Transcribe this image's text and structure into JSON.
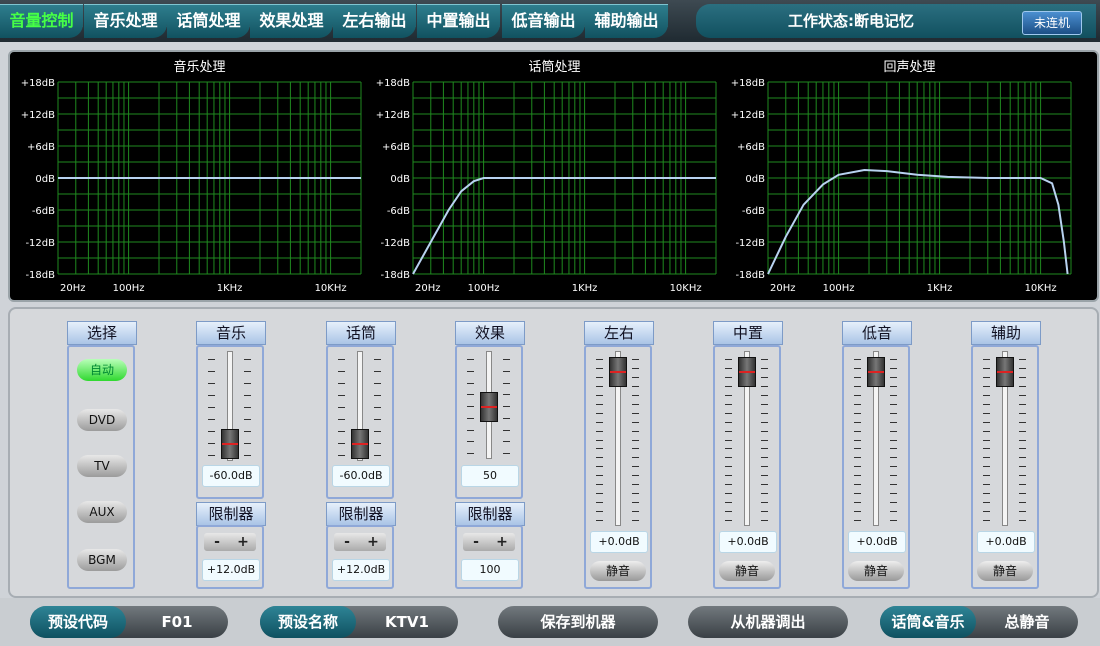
{
  "tabs": [
    {
      "label": "音量控制",
      "active": true
    },
    {
      "label": "音乐处理",
      "active": false
    },
    {
      "label": "话筒处理",
      "active": false
    },
    {
      "label": "效果处理",
      "active": false
    },
    {
      "label": "左右输出",
      "active": false
    },
    {
      "label": "中置输出",
      "active": false
    },
    {
      "label": "低音输出",
      "active": false
    },
    {
      "label": "辅助输出",
      "active": false
    }
  ],
  "status": {
    "text": "工作状态:断电记忆",
    "connect_label": "未连机"
  },
  "colors": {
    "active_tab": "#46ff46",
    "grid": "#1f8a1f",
    "curve": "#b8d2f0"
  },
  "graphs": [
    {
      "title": "音乐处理",
      "y_ticks": [
        "+18dB",
        "+12dB",
        "+6dB",
        "0dB",
        "-6dB",
        "-12dB",
        "-18dB"
      ],
      "x_ticks": [
        "20Hz",
        "100Hz",
        "1KHz",
        "10KHz"
      ],
      "curve": [
        [
          20,
          0
        ],
        [
          20000,
          0
        ]
      ]
    },
    {
      "title": "话筒处理",
      "y_ticks": [
        "+18dB",
        "+12dB",
        "+6dB",
        "0dB",
        "-6dB",
        "-12dB",
        "-18dB"
      ],
      "x_ticks": [
        "20Hz",
        "100Hz",
        "1KHz",
        "10KHz"
      ],
      "curve": [
        [
          20,
          -18
        ],
        [
          30,
          -12
        ],
        [
          45,
          -6
        ],
        [
          60,
          -2.5
        ],
        [
          80,
          -0.6
        ],
        [
          100,
          0
        ],
        [
          20000,
          0
        ]
      ]
    },
    {
      "title": "回声处理",
      "y_ticks": [
        "+18dB",
        "+12dB",
        "+6dB",
        "0dB",
        "-6dB",
        "-12dB",
        "-18dB"
      ],
      "x_ticks": [
        "20Hz",
        "100Hz",
        "1KHz",
        "10KHz"
      ],
      "curve": [
        [
          20,
          -18
        ],
        [
          30,
          -11
        ],
        [
          45,
          -5
        ],
        [
          70,
          -1.2
        ],
        [
          100,
          0.6
        ],
        [
          180,
          1.5
        ],
        [
          300,
          1.3
        ],
        [
          600,
          0.6
        ],
        [
          1200,
          0.2
        ],
        [
          3000,
          0
        ],
        [
          10000,
          0
        ],
        [
          13000,
          -1
        ],
        [
          15000,
          -5
        ],
        [
          17000,
          -12
        ],
        [
          18500,
          -18
        ]
      ]
    }
  ],
  "select": {
    "title": "选择",
    "options": [
      {
        "label": "自动",
        "on": true
      },
      {
        "label": "DVD",
        "on": false
      },
      {
        "label": "TV",
        "on": false
      },
      {
        "label": "AUX",
        "on": false
      },
      {
        "label": "BGM",
        "on": false
      }
    ]
  },
  "channels": [
    {
      "title": "音乐",
      "value": "-60.0dB",
      "level": 0.0,
      "limiter": {
        "title": "限制器",
        "value": "+12.0dB",
        "type": "stepper"
      }
    },
    {
      "title": "话筒",
      "value": "-60.0dB",
      "level": 0.0,
      "limiter": {
        "title": "限制器",
        "value": "+12.0dB",
        "type": "stepper"
      }
    },
    {
      "title": "效果",
      "value": "50",
      "level": 0.5,
      "limiter": {
        "title": "限制器",
        "value": "100",
        "type": "stepper"
      }
    },
    {
      "title": "左右",
      "value": "+0.0dB",
      "level": 1.0,
      "mute": "静音"
    },
    {
      "title": "中置",
      "value": "+0.0dB",
      "level": 1.0,
      "mute": "静音"
    },
    {
      "title": "低音",
      "value": "+0.0dB",
      "level": 1.0,
      "mute": "静音"
    },
    {
      "title": "辅助",
      "value": "+0.0dB",
      "level": 1.0,
      "mute": "静音"
    }
  ],
  "stepper": {
    "minus": "-",
    "plus": "+"
  },
  "bottom": {
    "preset_code_label": "预设代码",
    "preset_code_value": "F01",
    "preset_name_label": "预设名称",
    "preset_name_value": "KTV1",
    "save_label": "保存到机器",
    "load_label": "从机器调出",
    "mic_music_label": "话筒&音乐",
    "all_mute_label": "总静音"
  }
}
